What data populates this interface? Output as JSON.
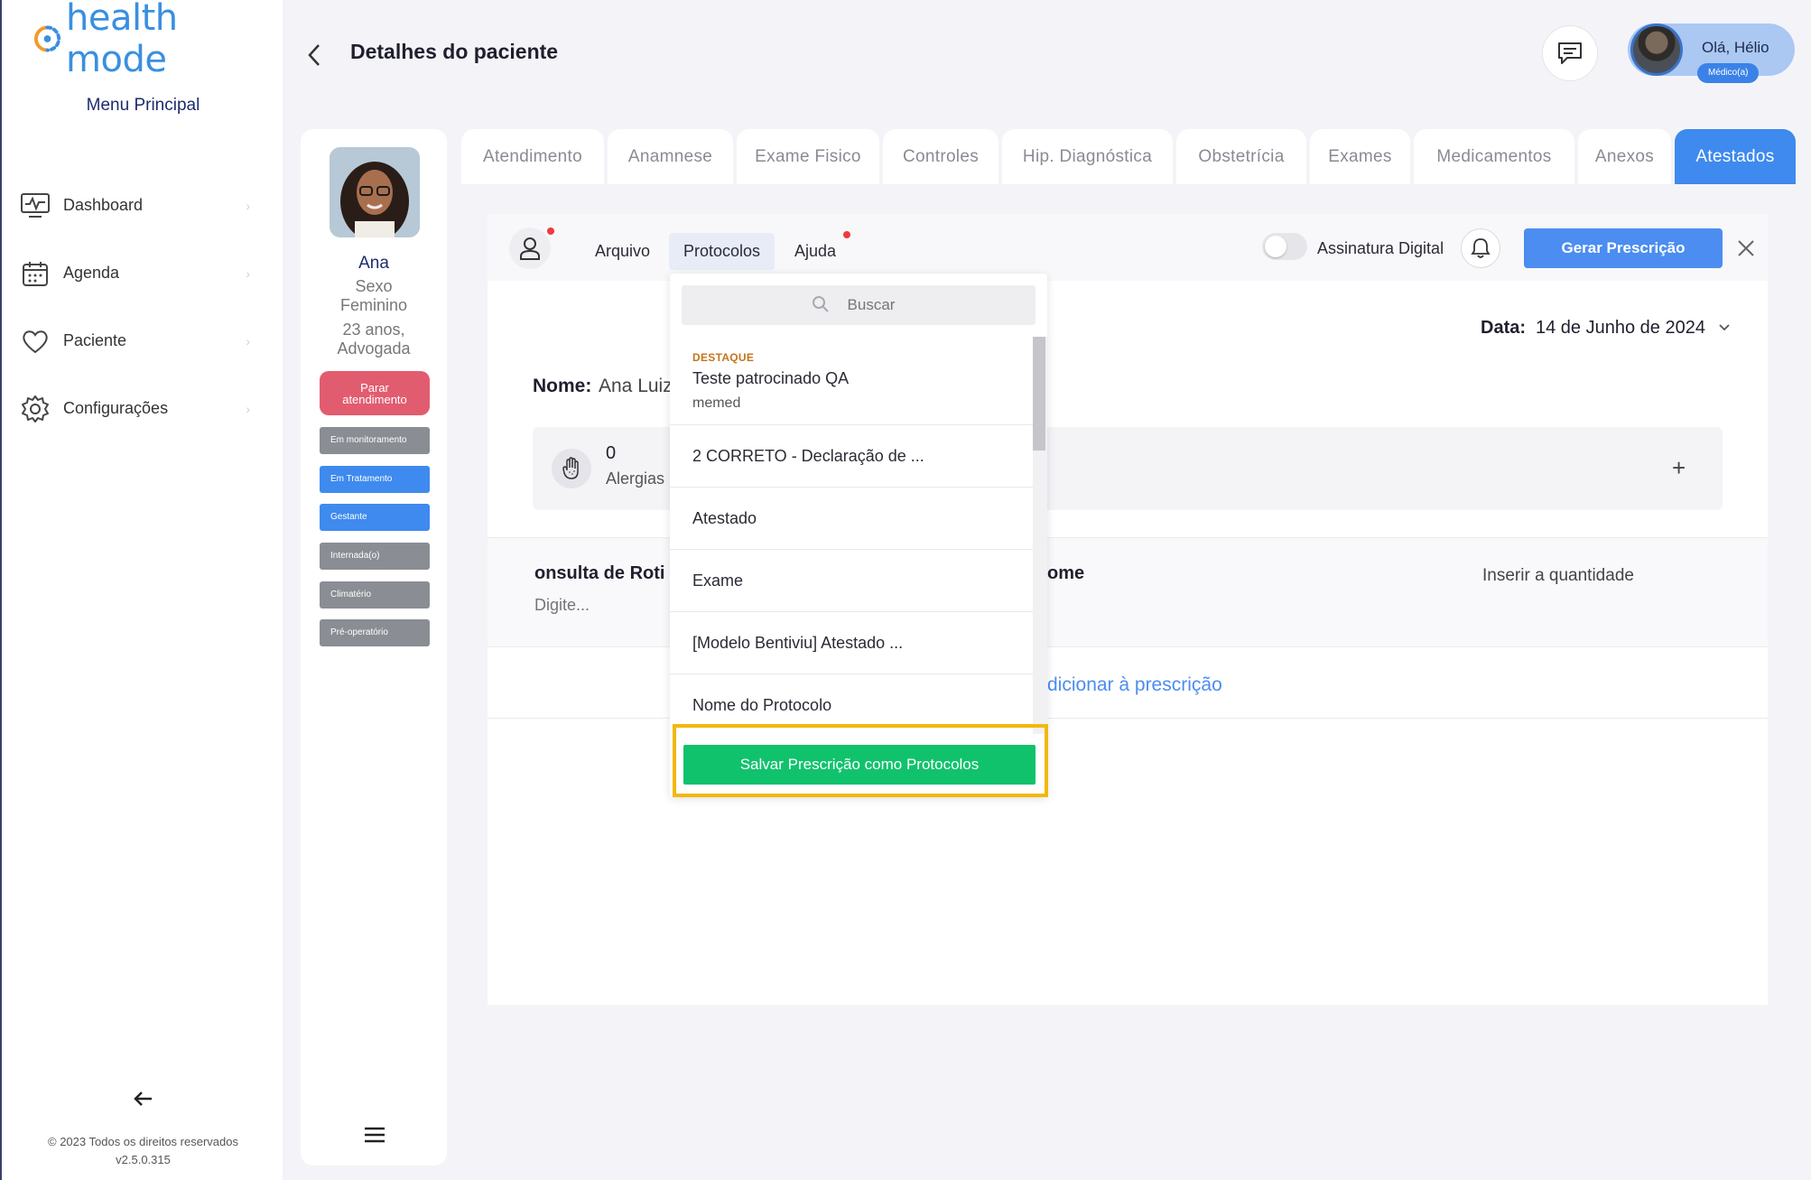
{
  "app": {
    "logo_text": "health mode",
    "menu_title": "Menu Principal",
    "copyright": "© 2023 Todos os direitos reservados",
    "version": "v2.5.0.315",
    "brand_color": "#3a8fe0"
  },
  "sidebar": {
    "items": [
      {
        "label": "Dashboard",
        "icon": "monitor-icon"
      },
      {
        "label": "Agenda",
        "icon": "calendar-icon"
      },
      {
        "label": "Paciente",
        "icon": "heart-icon"
      },
      {
        "label": "Configurações",
        "icon": "gear-icon"
      }
    ]
  },
  "header": {
    "title": "Detalhes do paciente",
    "greeting": "Olá, Hélio",
    "role": "Médico(a)"
  },
  "patient": {
    "name": "Ana",
    "sex_label": "Sexo",
    "sex_value": "Feminino",
    "age": "23 anos,",
    "occupation": "Advogada",
    "stop_button": "Parar atendimento",
    "tags": [
      {
        "label": "Em monitoramento",
        "color": "#8a8d93"
      },
      {
        "label": "Em Tratamento",
        "color": "#3e8aee"
      },
      {
        "label": "Gestante",
        "color": "#3e8aee"
      },
      {
        "label": "Internada(o)",
        "color": "#8a8d93"
      },
      {
        "label": "Climatério",
        "color": "#8a8d93"
      },
      {
        "label": "Pré-operatório",
        "color": "#8a8d93"
      }
    ]
  },
  "tabs": [
    {
      "label": "Atendimento",
      "active": false
    },
    {
      "label": "Anamnese",
      "active": false
    },
    {
      "label": "Exame Fisico",
      "active": false
    },
    {
      "label": "Controles",
      "active": false
    },
    {
      "label": "Hip. Diagnóstica",
      "active": false
    },
    {
      "label": "Obstetrícia",
      "active": false
    },
    {
      "label": "Exames",
      "active": false
    },
    {
      "label": "Medicamentos",
      "active": false
    },
    {
      "label": "Anexos",
      "active": false
    },
    {
      "label": "Atestados",
      "active": true
    }
  ],
  "toolbar": {
    "menu_arquivo": "Arquivo",
    "menu_protocolos": "Protocolos",
    "menu_ajuda": "Ajuda",
    "signature_label": "Assinatura Digital",
    "signature_enabled": false,
    "generate_button": "Gerar Prescrição"
  },
  "prescription": {
    "date_label": "Data:",
    "date_value": "14 de Junho de 2024",
    "name_label": "Nome:",
    "name_value": "Ana Luiz",
    "allergy_count": "0",
    "allergy_label": "Alergias",
    "consult_title": "onsulta de Roti",
    "consult_placeholder": "Digite...",
    "name_column_fragment": "ome",
    "quantity_label": "Inserir a quantidade",
    "add_link": "dicionar à prescrição"
  },
  "dropdown": {
    "search_placeholder": "Buscar",
    "featured": {
      "kicker": "DESTAQUE",
      "title": "Teste patrocinado QA",
      "subtitle": "memed"
    },
    "items": [
      "2 CORRETO - Declaração de ...",
      "Atestado",
      "Exame",
      "[Modelo Bentiviu] Atestado ...",
      "Nome do Protocolo"
    ],
    "save_button": "Salvar Prescrição como Protocolos",
    "highlight_color": "#f2b80c",
    "save_color": "#11c26d"
  }
}
